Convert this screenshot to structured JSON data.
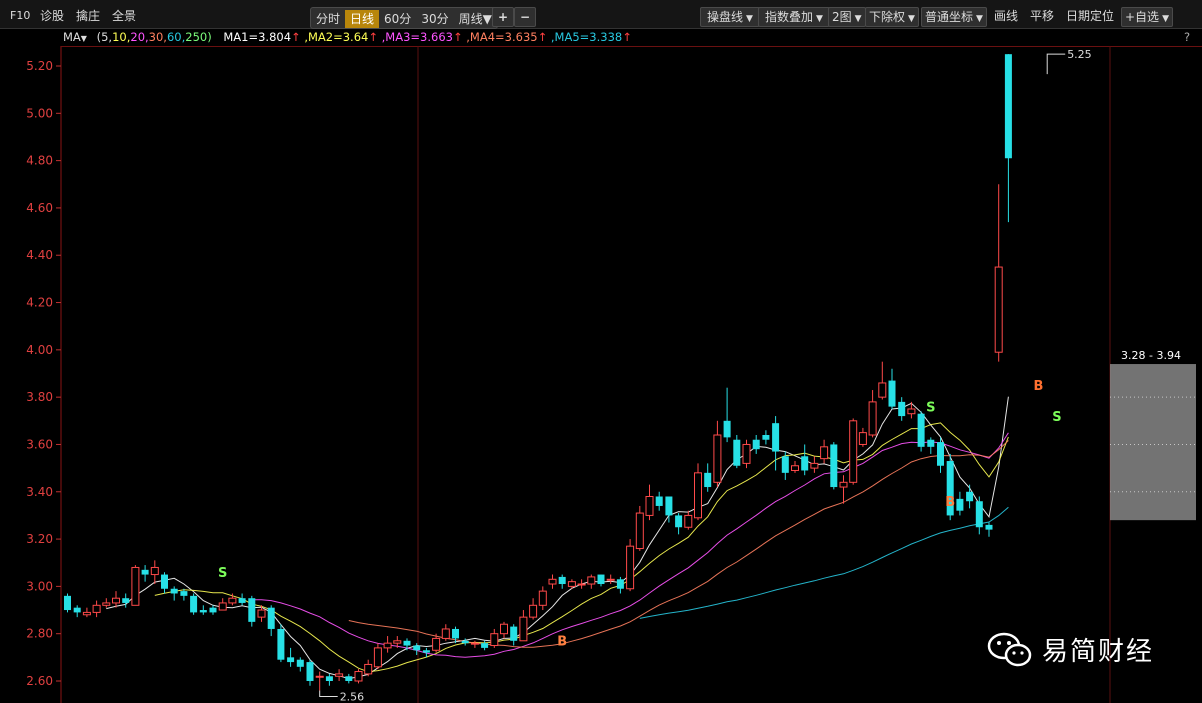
{
  "toolbar": {
    "f10": "F10",
    "diagnose": "诊股",
    "catch_dealer": "擒庄",
    "panorama": "全景",
    "periods": [
      "分时",
      "日线",
      "60分",
      "30分",
      "周线"
    ],
    "active_period": "日线",
    "zoom_in": "+",
    "zoom_out": "−",
    "right": [
      "操盘线",
      "指数叠加",
      "2图",
      "下除权",
      "普通坐标"
    ],
    "draw": "画线",
    "pan": "平移",
    "date_locate": "日期定位",
    "watchlist": "+自选",
    "help": "?"
  },
  "ma_bar": {
    "name": "MA",
    "params_open": "(5,",
    "p10": "10,",
    "p20": "20,",
    "p30": "30,",
    "p60": "60,",
    "p250": "250)",
    "ma1": "MA1=3.804",
    "ma2": ",MA2=3.64",
    "ma3": ",MA3=3.663",
    "ma4": ",MA4=3.635",
    "ma5": ",MA5=3.338",
    "arrow": "↑"
  },
  "colors": {
    "up": "#ff4a4a",
    "down": "#27e0e6",
    "ma1": "#ffffff",
    "ma2": "#ffff55",
    "ma3": "#ff55ff",
    "ma4": "#ff8060",
    "ma5": "#28c8e0",
    "axis_text": "#e04040",
    "grid": "#5a1010"
  },
  "chart_data": {
    "type": "candlestick",
    "ylim": [
      2.55,
      5.3
    ],
    "yticks": [
      2.6,
      2.8,
      3.0,
      3.2,
      3.4,
      3.6,
      3.8,
      4.0,
      4.2,
      4.4,
      4.6,
      4.8,
      5.0,
      5.2
    ],
    "ytick_labels": [
      "2.60",
      "2.80",
      "3.00",
      "3.20",
      "3.40",
      "3.60",
      "3.80",
      "4.00",
      "4.20",
      "4.40",
      "4.60",
      "4.80",
      "5.00",
      "5.20"
    ],
    "candles": [
      [
        2.96,
        2.9,
        2.97,
        2.89
      ],
      [
        2.91,
        2.89,
        2.92,
        2.87
      ],
      [
        2.88,
        2.89,
        2.91,
        2.87
      ],
      [
        2.89,
        2.92,
        2.94,
        2.87
      ],
      [
        2.92,
        2.93,
        2.95,
        2.91
      ],
      [
        2.93,
        2.95,
        2.98,
        2.91
      ],
      [
        2.95,
        2.93,
        2.97,
        2.91
      ],
      [
        2.92,
        3.08,
        3.09,
        2.92
      ],
      [
        3.07,
        3.05,
        3.09,
        3.02
      ],
      [
        3.05,
        3.08,
        3.11,
        3.01
      ],
      [
        3.05,
        2.99,
        3.06,
        2.97
      ],
      [
        2.99,
        2.97,
        3.0,
        2.94
      ],
      [
        2.98,
        2.96,
        2.99,
        2.94
      ],
      [
        2.96,
        2.89,
        2.97,
        2.88
      ],
      [
        2.9,
        2.89,
        2.92,
        2.88
      ],
      [
        2.91,
        2.89,
        2.92,
        2.88
      ],
      [
        2.9,
        2.93,
        2.95,
        2.9
      ],
      [
        2.93,
        2.95,
        2.97,
        2.92
      ],
      [
        2.95,
        2.93,
        2.97,
        2.92
      ],
      [
        2.95,
        2.85,
        2.96,
        2.83
      ],
      [
        2.87,
        2.9,
        2.92,
        2.85
      ],
      [
        2.91,
        2.82,
        2.92,
        2.79
      ],
      [
        2.82,
        2.69,
        2.84,
        2.68
      ],
      [
        2.7,
        2.68,
        2.74,
        2.66
      ],
      [
        2.69,
        2.66,
        2.7,
        2.64
      ],
      [
        2.68,
        2.6,
        2.69,
        2.58
      ],
      [
        2.62,
        2.62,
        2.64,
        2.56
      ],
      [
        2.62,
        2.6,
        2.63,
        2.58
      ],
      [
        2.62,
        2.63,
        2.65,
        2.6
      ],
      [
        2.62,
        2.6,
        2.63,
        2.59
      ],
      [
        2.6,
        2.64,
        2.65,
        2.59
      ],
      [
        2.63,
        2.67,
        2.69,
        2.62
      ],
      [
        2.66,
        2.74,
        2.76,
        2.65
      ],
      [
        2.74,
        2.76,
        2.79,
        2.72
      ],
      [
        2.76,
        2.77,
        2.79,
        2.74
      ],
      [
        2.77,
        2.75,
        2.78,
        2.73
      ],
      [
        2.75,
        2.73,
        2.76,
        2.71
      ],
      [
        2.73,
        2.72,
        2.74,
        2.7
      ],
      [
        2.73,
        2.78,
        2.8,
        2.72
      ],
      [
        2.78,
        2.82,
        2.84,
        2.77
      ],
      [
        2.82,
        2.78,
        2.83,
        2.76
      ],
      [
        2.77,
        2.76,
        2.78,
        2.75
      ],
      [
        2.76,
        2.76,
        2.77,
        2.74
      ],
      [
        2.76,
        2.74,
        2.77,
        2.73
      ],
      [
        2.75,
        2.8,
        2.82,
        2.74
      ],
      [
        2.8,
        2.84,
        2.85,
        2.78
      ],
      [
        2.83,
        2.77,
        2.84,
        2.75
      ],
      [
        2.77,
        2.87,
        2.9,
        2.77
      ],
      [
        2.87,
        2.92,
        2.95,
        2.86
      ],
      [
        2.92,
        2.98,
        3.0,
        2.9
      ],
      [
        3.01,
        3.03,
        3.05,
        2.99
      ],
      [
        3.04,
        3.01,
        3.05,
        2.99
      ],
      [
        3.0,
        3.02,
        3.03,
        2.99
      ],
      [
        3.01,
        3.01,
        3.03,
        2.99
      ],
      [
        3.01,
        3.04,
        3.05,
        2.99
      ],
      [
        3.05,
        3.01,
        3.05,
        3.0
      ],
      [
        3.03,
        3.03,
        3.05,
        3.01
      ],
      [
        3.03,
        2.99,
        3.04,
        2.97
      ],
      [
        2.99,
        3.17,
        3.2,
        2.98
      ],
      [
        3.16,
        3.31,
        3.34,
        3.15
      ],
      [
        3.3,
        3.38,
        3.43,
        3.28
      ],
      [
        3.38,
        3.34,
        3.4,
        3.32
      ],
      [
        3.38,
        3.3,
        3.38,
        3.27
      ],
      [
        3.3,
        3.25,
        3.31,
        3.22
      ],
      [
        3.25,
        3.3,
        3.32,
        3.24
      ],
      [
        3.29,
        3.48,
        3.52,
        3.28
      ],
      [
        3.48,
        3.42,
        3.52,
        3.4
      ],
      [
        3.44,
        3.64,
        3.7,
        3.42
      ],
      [
        3.7,
        3.63,
        3.84,
        3.61
      ],
      [
        3.62,
        3.51,
        3.64,
        3.5
      ],
      [
        3.52,
        3.6,
        3.62,
        3.5
      ],
      [
        3.62,
        3.58,
        3.64,
        3.56
      ],
      [
        3.64,
        3.62,
        3.66,
        3.6
      ],
      [
        3.69,
        3.57,
        3.72,
        3.49
      ],
      [
        3.55,
        3.48,
        3.57,
        3.45
      ],
      [
        3.49,
        3.51,
        3.53,
        3.48
      ],
      [
        3.55,
        3.49,
        3.6,
        3.47
      ],
      [
        3.5,
        3.52,
        3.55,
        3.48
      ],
      [
        3.54,
        3.59,
        3.62,
        3.52
      ],
      [
        3.6,
        3.42,
        3.61,
        3.41
      ],
      [
        3.42,
        3.44,
        3.47,
        3.35
      ],
      [
        3.44,
        3.7,
        3.71,
        3.43
      ],
      [
        3.6,
        3.65,
        3.67,
        3.59
      ],
      [
        3.64,
        3.78,
        3.83,
        3.63
      ],
      [
        3.8,
        3.86,
        3.95,
        3.79
      ],
      [
        3.87,
        3.76,
        3.92,
        3.75
      ],
      [
        3.78,
        3.72,
        3.8,
        3.7
      ],
      [
        3.73,
        3.75,
        3.78,
        3.71
      ],
      [
        3.73,
        3.59,
        3.74,
        3.57
      ],
      [
        3.62,
        3.59,
        3.63,
        3.56
      ],
      [
        3.61,
        3.51,
        3.63,
        3.48
      ],
      [
        3.53,
        3.3,
        3.56,
        3.28
      ],
      [
        3.37,
        3.32,
        3.4,
        3.3
      ],
      [
        3.4,
        3.36,
        3.43,
        3.33
      ],
      [
        3.36,
        3.25,
        3.38,
        3.22
      ],
      [
        3.26,
        3.24,
        3.27,
        3.21
      ],
      [
        3.99,
        4.35,
        4.7,
        3.95
      ],
      [
        5.25,
        4.81,
        5.25,
        4.54
      ]
    ],
    "labels": [
      "S",
      "B",
      "S",
      "B",
      "S"
    ],
    "low_annotation": "2.56",
    "high_annotation": "5.25",
    "range_label": "3.28 - 3.94",
    "buy_label": "B"
  },
  "watermark": {
    "text": "易简财经"
  }
}
